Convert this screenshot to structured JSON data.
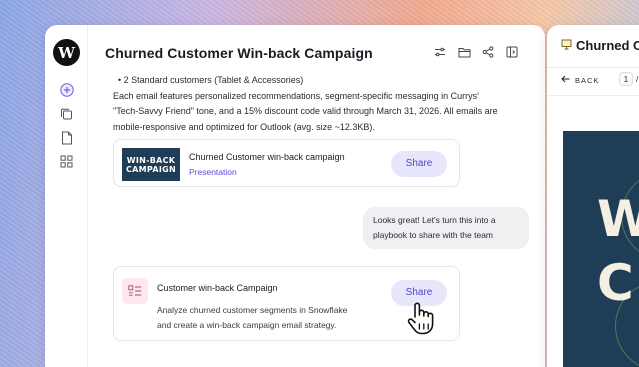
{
  "left_window": {
    "logo_letter": "W",
    "title": "Churned Customer Win-back Campaign",
    "toolbar": {
      "icons": [
        "sliders-icon",
        "folder-icon",
        "share-nodes-icon",
        "sidebar-panel-icon"
      ]
    },
    "rail_icons": [
      "plus-icon",
      "copy-icon",
      "document-icon",
      "grid-icon"
    ],
    "message": {
      "bullet": "•  2 Standard customers (Tablet & Accessories)",
      "paragraph_line1": "Each email features personalized recommendations, segment-specific messaging in Currys'",
      "paragraph_line2": "\"Tech-Savvy Friend\" tone, and a 15% discount code valid through March 31, 2026. All emails are",
      "paragraph_line3": "mobile-responsive and optimized for Outlook (avg. size ~12.3KB)."
    },
    "attachment_card": {
      "thumb_line1": "WIN-BACK",
      "thumb_line2": "CAMPAIGN",
      "title": "Churned Customer win-back campaign",
      "subtitle": "Presentation",
      "share_label": "Share"
    },
    "user_bubble": {
      "line1": "Looks great! Let's turn this into a",
      "line2": "playbook to share with the team"
    },
    "playbook_card": {
      "title": "Customer win-back Campaign",
      "desc_line1": "Analyze churned customer segments in Snowflake",
      "desc_line2": "and create a win-back campaign email strategy.",
      "share_label": "Share"
    }
  },
  "right_window": {
    "title": "Churned C",
    "back_label": "BACK",
    "page_current": "1",
    "page_separator": "/",
    "slide_text_line1": "W",
    "slide_text_line2": "C"
  },
  "colors": {
    "accent": "#4f47c9",
    "share_bg": "#e7e6fb",
    "slide_bg": "#1f3d57"
  }
}
